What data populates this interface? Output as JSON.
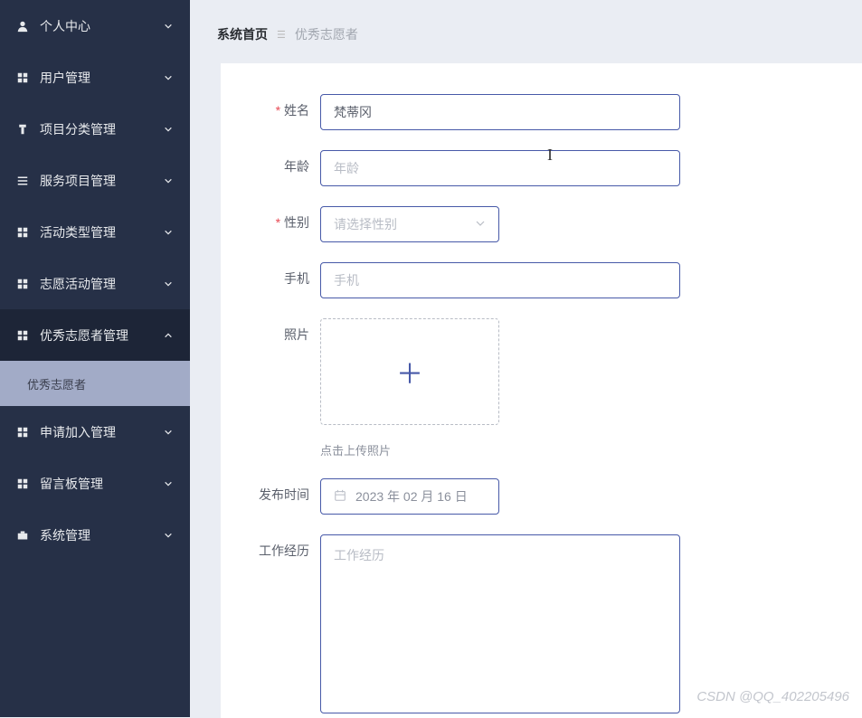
{
  "sidebar": {
    "items": [
      {
        "label": "个人中心",
        "icon": "person"
      },
      {
        "label": "用户管理",
        "icon": "grid"
      },
      {
        "label": "项目分类管理",
        "icon": "tag"
      },
      {
        "label": "服务项目管理",
        "icon": "list"
      },
      {
        "label": "活动类型管理",
        "icon": "grid"
      },
      {
        "label": "志愿活动管理",
        "icon": "grid"
      },
      {
        "label": "优秀志愿者管理",
        "icon": "grid"
      },
      {
        "label": "申请加入管理",
        "icon": "grid"
      },
      {
        "label": "留言板管理",
        "icon": "grid"
      },
      {
        "label": "系统管理",
        "icon": "briefcase"
      }
    ],
    "submenu": {
      "label": "优秀志愿者"
    }
  },
  "breadcrumb": {
    "home": "系统首页",
    "current": "优秀志愿者"
  },
  "form": {
    "name": {
      "label": "姓名",
      "value": "梵蒂冈"
    },
    "age": {
      "label": "年龄",
      "placeholder": "年龄"
    },
    "gender": {
      "label": "性别",
      "placeholder": "请选择性别"
    },
    "phone": {
      "label": "手机",
      "placeholder": "手机"
    },
    "photo": {
      "label": "照片",
      "hint": "点击上传照片"
    },
    "publishDate": {
      "label": "发布时间",
      "value": "2023 年 02 月 16 日"
    },
    "workHistory": {
      "label": "工作经历",
      "placeholder": "工作经历"
    }
  },
  "watermark": "CSDN @QQ_402205496"
}
